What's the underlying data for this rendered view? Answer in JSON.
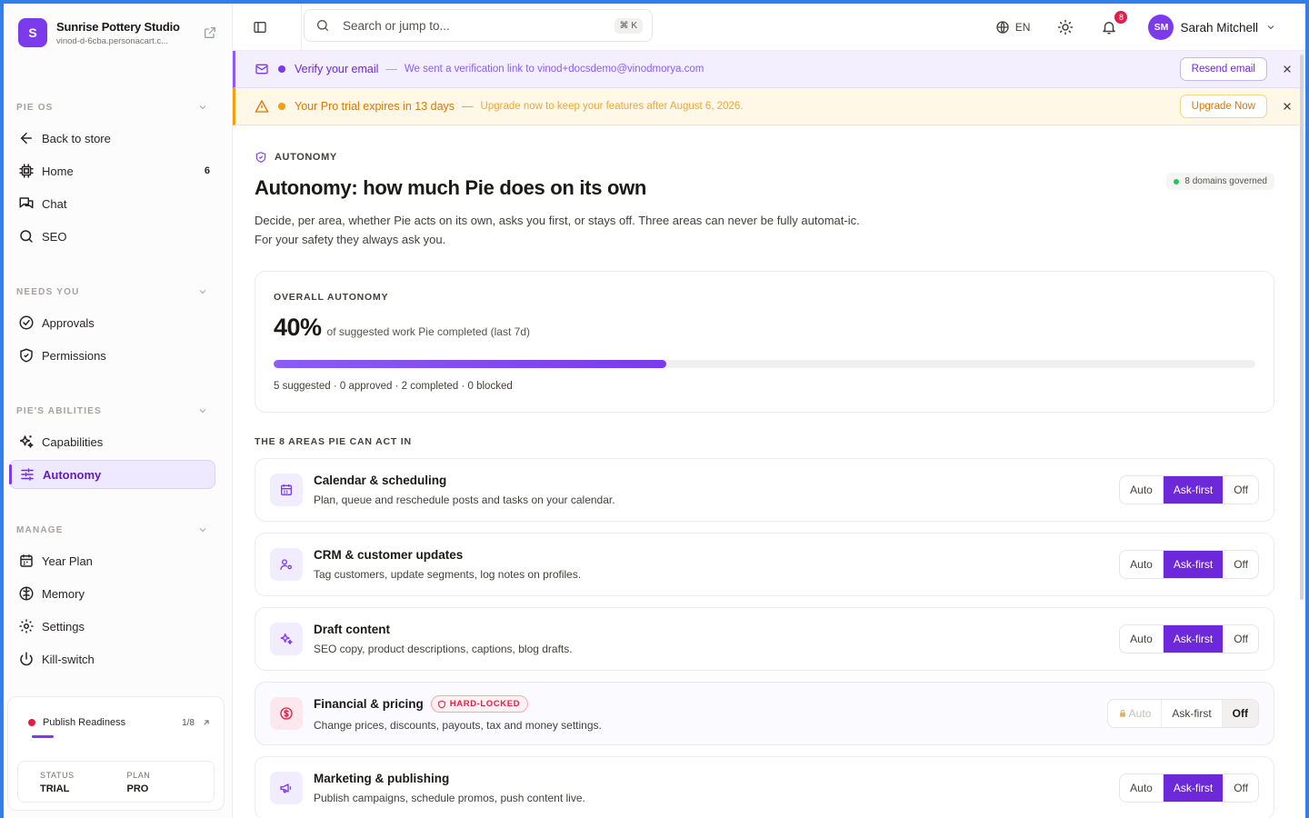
{
  "brand": {
    "initial": "S",
    "name": "Sunrise Pottery Studio",
    "url": "vinod-d-6cba.personacart.c..."
  },
  "sidebar": {
    "sections": [
      {
        "title": "PIE OS",
        "items": [
          {
            "label": "Back to store",
            "icon": "arrow-left-icon"
          },
          {
            "label": "Home",
            "icon": "home-chip-icon",
            "count": "6"
          },
          {
            "label": "Chat",
            "icon": "chat-icon"
          },
          {
            "label": "SEO",
            "icon": "search-icon"
          }
        ]
      },
      {
        "title": "NEEDS YOU",
        "items": [
          {
            "label": "Approvals",
            "icon": "check-circle-icon"
          },
          {
            "label": "Permissions",
            "icon": "shield-check-icon"
          }
        ]
      },
      {
        "title": "PIE'S ABILITIES",
        "items": [
          {
            "label": "Capabilities",
            "icon": "sparkles-icon"
          },
          {
            "label": "Autonomy",
            "icon": "sliders-icon",
            "active": true
          }
        ]
      },
      {
        "title": "MANAGE",
        "items": [
          {
            "label": "Year Plan",
            "icon": "calendar-icon"
          },
          {
            "label": "Memory",
            "icon": "brain-icon"
          },
          {
            "label": "Settings",
            "icon": "gear-icon"
          },
          {
            "label": "Kill-switch",
            "icon": "power-icon"
          }
        ]
      }
    ],
    "publish": {
      "label": "Publish Readiness",
      "progress": "1/8",
      "progress_fraction": 0.125
    },
    "status": {
      "status_label": "STATUS",
      "status_value": "TRIAL",
      "plan_label": "PLAN",
      "plan_value": "PRO"
    }
  },
  "topbar": {
    "search_placeholder": "Search or jump to...",
    "shortcut": "⌘ K",
    "language": "EN",
    "notifications_count": "8",
    "user_initials": "SM",
    "user_name": "Sarah Mitchell"
  },
  "banners": {
    "verify": {
      "title": "Verify your email",
      "sep": "—",
      "desc": "We sent a verification link to vinod+docsdemo@vinodmorya.com",
      "button": "Resend email"
    },
    "trial": {
      "title": "Your Pro trial expires in 13 days",
      "sep": "—",
      "desc": "Upgrade now to keep your features after August 6, 2026.",
      "button": "Upgrade Now"
    }
  },
  "page": {
    "kicker": "AUTONOMY",
    "governed": "8 domains governed",
    "title": "Autonomy: how much Pie does on its own",
    "description": "Decide, per area, whether Pie acts on its own, asks you first, or stays off. Three areas can never be fully automat-ic. For your safety they always ask you."
  },
  "overall": {
    "label": "OVERALL AUTONOMY",
    "percent": "40%",
    "percent_value": 40,
    "subtitle": "of suggested work Pie completed (last 7d)",
    "stats": "5 suggested · 0 approved · 2 completed · 0 blocked"
  },
  "areas_heading": "THE 8 AREAS PIE CAN ACT IN",
  "areas": [
    {
      "title": "Calendar & scheduling",
      "desc": "Plan, queue and reschedule posts and tasks on your calendar.",
      "icon": "calendar-grid-icon",
      "mode": "Ask-first",
      "locked": false
    },
    {
      "title": "CRM & customer updates",
      "desc": "Tag customers, update segments, log notes on profiles.",
      "icon": "user-gear-icon",
      "mode": "Ask-first",
      "locked": false
    },
    {
      "title": "Draft content",
      "desc": "SEO copy, product descriptions, captions, blog drafts.",
      "icon": "sparkles-icon",
      "mode": "Ask-first",
      "locked": false
    },
    {
      "title": "Financial & pricing",
      "desc": "Change prices, discounts, payouts, tax and money settings.",
      "icon": "dollar-circle-icon",
      "mode": "Off",
      "locked": true,
      "badge": "HARD-LOCKED"
    },
    {
      "title": "Marketing & publishing",
      "desc": "Publish campaigns, schedule promos, push content live.",
      "icon": "megaphone-icon",
      "mode": "Ask-first",
      "locked": false
    }
  ],
  "mode_labels": {
    "auto": "Auto",
    "ask": "Ask-first",
    "off": "Off"
  },
  "colors": {
    "accent": "#7c3aed",
    "accent_dark": "#6d28d9",
    "warning": "#f59e0b",
    "danger": "#e11d48"
  }
}
